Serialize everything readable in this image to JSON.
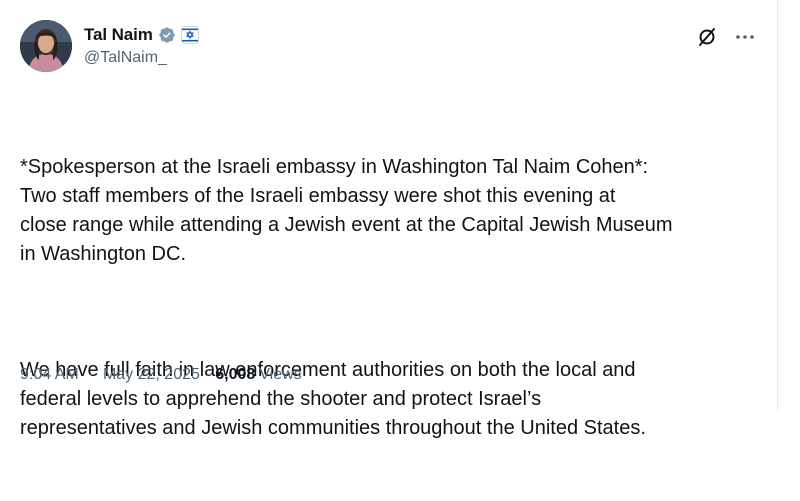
{
  "author": {
    "display_name": "Tal Naim",
    "handle": "@TalNaim_",
    "verified_color": "#829aab",
    "affiliation_badge": "israel-flag-icon"
  },
  "tweet": {
    "paragraphs": [
      "*Spokesperson at the Israeli embassy in Washington Tal Naim Cohen*:\nTwo staff members of the Israeli embassy were shot this evening at\nclose range while attending a Jewish event at the Capital Jewish Museum\nin Washington DC.",
      "We have full faith in law enforcement authorities on both the local and\nfederal levels to apprehend the shooter and protect Israel’s\nrepresentatives and Jewish communities throughout the United States."
    ]
  },
  "meta": {
    "time": "9:04 AM",
    "separator": "·",
    "date": "May 22, 2025",
    "views_count": "6,008",
    "views_label": "Views"
  },
  "icons": {
    "grok": "grok-icon",
    "more": "more-icon"
  },
  "colors": {
    "text": "#0f1419",
    "secondary": "#536471",
    "border": "#e6ecf0"
  }
}
